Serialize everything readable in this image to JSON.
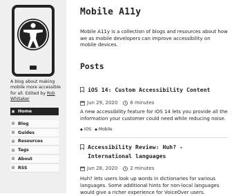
{
  "sidebar": {
    "tagline_prefix": "A blog about making mobile more accessible for all. Edited by ",
    "editor_link": "Rob Whitaker",
    "nav": [
      {
        "label": "Home",
        "icon": "home-icon",
        "active": true
      },
      {
        "label": "Blog",
        "icon": "blog-icon"
      },
      {
        "label": "Guides",
        "icon": "guides-icon"
      },
      {
        "label": "Resources",
        "icon": "resources-icon"
      },
      {
        "label": "Tags",
        "icon": "tags-icon"
      },
      {
        "label": "About",
        "icon": "about-icon"
      },
      {
        "label": "RSS",
        "icon": "rss-icon"
      }
    ]
  },
  "header": {
    "title": "Mobile A11y"
  },
  "intro": "Mobile A11y is a collection of blogs and resources about how we as mobile developers can improve accessibility on mobile devices.",
  "posts_heading": "Posts",
  "posts": [
    {
      "title": "iOS 14: Custom Accessibility Content",
      "date": "Jun 29, 2020",
      "read_time": "6 minutes",
      "excerpt": "A new accessibility feature for iOS 14 lets you provide all the information your customer could need while reducing noise.",
      "tags": [
        "iOS",
        "Mobile"
      ]
    },
    {
      "title": "Accessibility Review: Huh? - International languages",
      "date": "Jun 28, 2020",
      "read_time": "2 minutes",
      "excerpt": "Huh? lets users look up words in dictionaries for various languages. Some additional hints for non-local languages would give a richer experience for VoiceOver users."
    }
  ],
  "colors": {
    "sidebar_bg": "#efefef",
    "text": "#222222",
    "active_nav": "#222222"
  }
}
